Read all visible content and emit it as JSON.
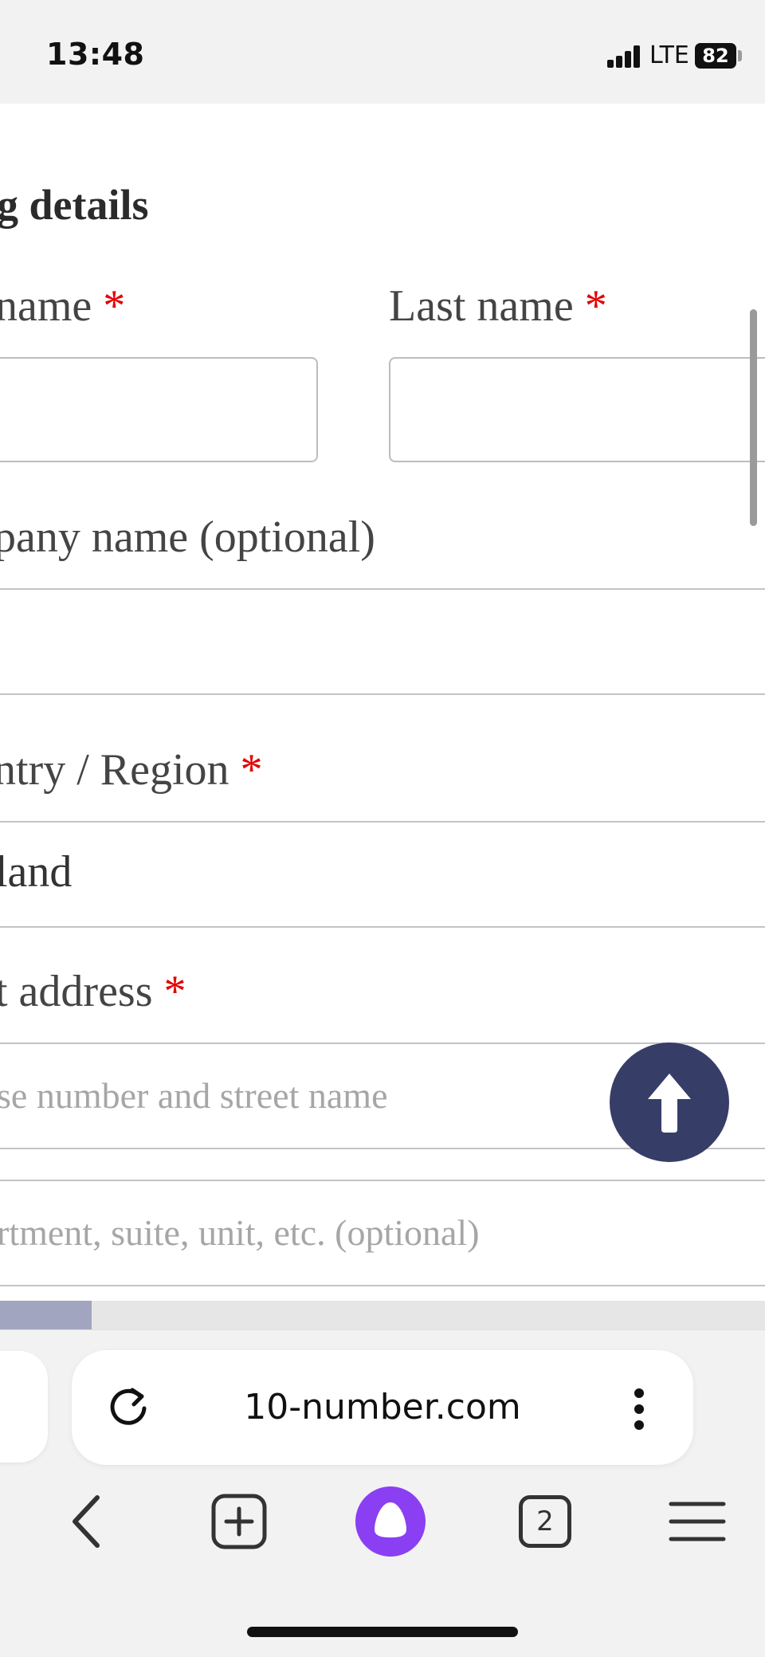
{
  "status_bar": {
    "time": "13:48",
    "network": "LTE",
    "battery": "82",
    "icons": [
      "signal-icon",
      "battery-icon"
    ]
  },
  "form": {
    "heading": "g details",
    "first_name_label": "name",
    "last_name_label": "Last name",
    "company_label": "pany name (optional)",
    "country_label": "ntry / Region",
    "country_value": "land",
    "street_label": "t address",
    "street_placeholder": "se number and street name",
    "apartment_placeholder": "rtment, suite, unit, etc. (optional)",
    "required_marker": "*",
    "colors": {
      "required": "#e30000",
      "back_to_top": "#363d67"
    }
  },
  "page_progress": {
    "fraction": 0.12,
    "color": "#a2a5bf"
  },
  "browser": {
    "url": "10-number.com",
    "tab_count": "2",
    "icons": [
      "reload-icon",
      "more-icon",
      "back-icon",
      "new-tab-icon",
      "alice-assistant-icon",
      "tabs-icon",
      "menu-icon"
    ],
    "assistant_color": "#8a3ff2"
  }
}
